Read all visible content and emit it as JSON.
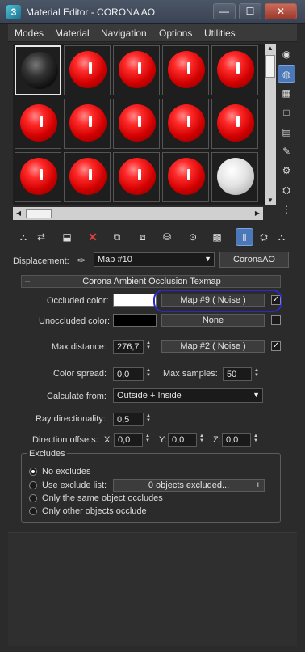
{
  "window": {
    "title": "Material Editor - CORONA AO",
    "app_icon_letter": "3",
    "minimize": "—",
    "maximize": "☐",
    "close": "✕"
  },
  "menu": [
    "Modes",
    "Material",
    "Navigation",
    "Options",
    "Utilities"
  ],
  "slots": [
    "black",
    "red",
    "red",
    "red",
    "red",
    "red",
    "red",
    "red",
    "red",
    "red",
    "red",
    "red",
    "red",
    "red",
    "white"
  ],
  "displacement": {
    "label": "Displacement:",
    "map_name": "Map #10",
    "map_type": "CoronaAO"
  },
  "rollout": {
    "title": "Corona Ambient Occlusion Texmap",
    "collapse": "–"
  },
  "occluded": {
    "label": "Occluded color:",
    "map": "Map #9  ( Noise )",
    "checked": "✓"
  },
  "unoccluded": {
    "label": "Unoccluded color:",
    "map": "None"
  },
  "max_distance": {
    "label": "Max distance:",
    "value": "276,7:",
    "map": "Map #2  ( Noise )",
    "checked": "✓"
  },
  "color_spread": {
    "label": "Color spread:",
    "value": "0,0"
  },
  "max_samples": {
    "label": "Max samples:",
    "value": "50"
  },
  "calc_from": {
    "label": "Calculate from:",
    "value": "Outside + Inside"
  },
  "ray_dir": {
    "label": "Ray directionality:",
    "value": "0,5"
  },
  "dir_offsets": {
    "label": "Direction offsets:",
    "x_label": "X:",
    "x": "0,0",
    "y_label": "Y:",
    "y": "0,0",
    "z_label": "Z:",
    "z": "0,0"
  },
  "excludes": {
    "title": "Excludes",
    "options": [
      "No excludes",
      "Use exclude list:",
      "Only the same object occludes",
      "Only other objects occlude"
    ],
    "selected": 0,
    "exclude_button": "0 objects excluded...",
    "add": "+"
  },
  "icons": {
    "toolbar": [
      "get-material-icon",
      "put-to-scene-icon",
      "assign-to-selection-icon",
      "reset-map-icon",
      "delete-icon",
      "copy-material-icon",
      "make-unique-icon",
      "put-to-library-icon",
      "material-id-icon",
      "show-in-viewport-icon",
      "show-end-result-icon",
      "go-to-parent-icon",
      "go-forward-icon"
    ],
    "side": [
      "sample-type-icon",
      "backlight-icon",
      "background-icon",
      "uv-tiling-icon",
      "video-check-icon",
      "make-preview-icon",
      "options-icon",
      "select-by-material-icon",
      "material-navigator-icon"
    ]
  },
  "colors": {
    "occluded_swatch": "#ffffff",
    "unoccluded_swatch": "#000000",
    "accent": "#4a78b8",
    "annotation": "#2a2ac8"
  }
}
